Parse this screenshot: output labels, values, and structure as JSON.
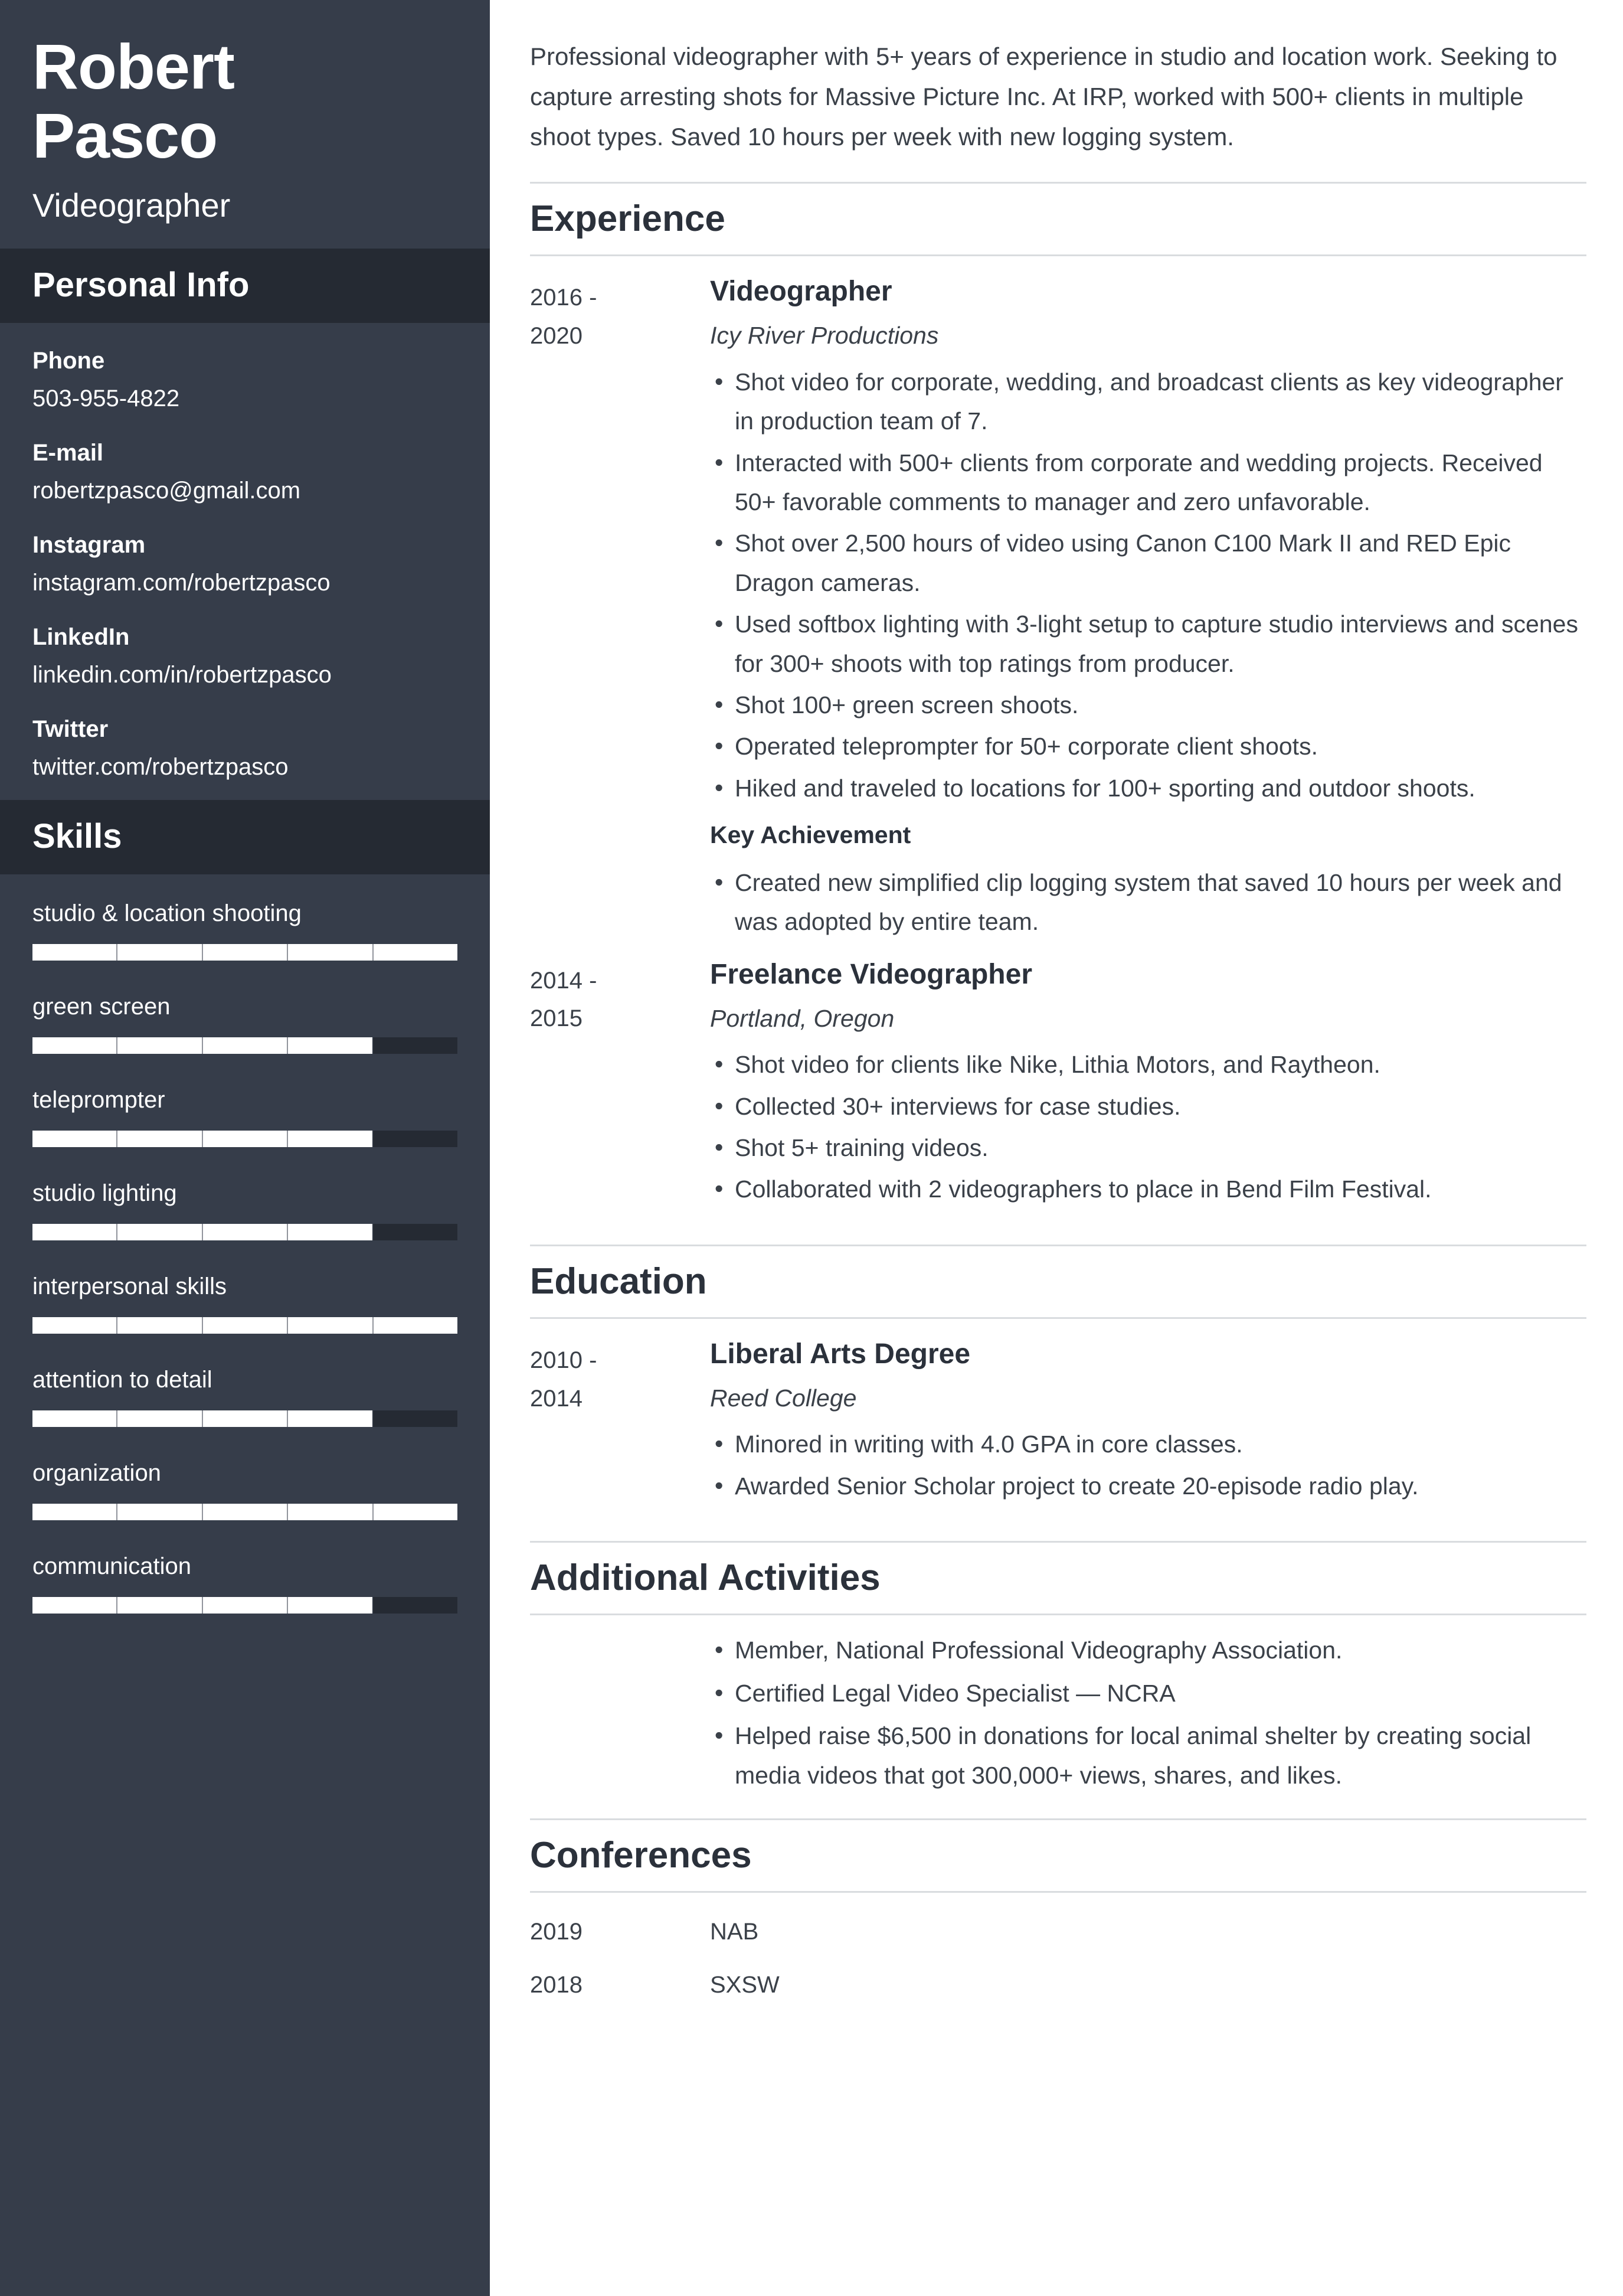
{
  "theme": {
    "sidebar_bg": "#363d4a",
    "sidebar_header_bg": "#252a33",
    "skill_track_bg": "#252a33",
    "skill_fill": "#ffffff",
    "main_bg": "#ffffff",
    "text_dark": "#3b4149",
    "heading_dark": "#2b313b",
    "rule": "#d9dcdf"
  },
  "sidebar": {
    "first_name": "Robert",
    "last_name": "Pasco",
    "job_title": "Videographer",
    "personal_info_heading": "Personal Info",
    "contacts": [
      {
        "label": "Phone",
        "value": "503-955-4822"
      },
      {
        "label": "E-mail",
        "value": "robertzpasco@gmail.com"
      },
      {
        "label": "Instagram",
        "value": "instagram.com/robertzpasco"
      },
      {
        "label": "LinkedIn",
        "value": "linkedin.com/in/robertzpasco"
      },
      {
        "label": "Twitter",
        "value": "twitter.com/robertzpasco"
      }
    ],
    "skills_heading": "Skills",
    "skills": [
      {
        "label": "studio & location shooting",
        "level": 100
      },
      {
        "label": "green screen",
        "level": 80
      },
      {
        "label": "teleprompter",
        "level": 80
      },
      {
        "label": "studio lighting",
        "level": 80
      },
      {
        "label": "interpersonal skills",
        "level": 100
      },
      {
        "label": "attention to detail",
        "level": 80
      },
      {
        "label": "organization",
        "level": 100
      },
      {
        "label": "communication",
        "level": 80
      }
    ]
  },
  "main": {
    "summary": "Professional videographer with 5+ years of experience in studio and location work. Seeking to capture arresting shots for Massive Picture Inc. At IRP, worked with 500+ clients in multiple shoot types. Saved 10 hours per week with new logging system.",
    "experience": {
      "title": "Experience",
      "entries": [
        {
          "date_from": "2016 -",
          "date_to": "2020",
          "role": "Videographer",
          "org": "Icy River Productions",
          "bullets": [
            "Shot video for corporate, wedding, and broadcast clients as key videographer in production team of 7.",
            "Interacted with 500+ clients from corporate and wedding projects. Received 50+ favorable comments to manager and zero unfavorable.",
            "Shot over 2,500 hours of video using Canon C100 Mark II and RED Epic Dragon cameras.",
            "Used softbox lighting with 3-light setup to capture studio interviews and scenes for 300+ shoots with top ratings from producer.",
            "Shot 100+ green screen shoots.",
            "Operated teleprompter for 50+ corporate client shoots.",
            "Hiked and traveled to locations for 100+ sporting and outdoor shoots."
          ],
          "achievement_label": "Key Achievement",
          "achievement_bullets": [
            "Created new simplified clip logging system that saved 10 hours per week and was adopted by entire team."
          ]
        },
        {
          "date_from": "2014 -",
          "date_to": "2015",
          "role": "Freelance Videographer",
          "org": "Portland, Oregon",
          "bullets": [
            "Shot video for clients like Nike, Lithia Motors, and Raytheon.",
            "Collected 30+ interviews for case studies.",
            "Shot 5+ training videos.",
            "Collaborated with 2 videographers to place in Bend Film Festival."
          ],
          "achievement_label": "",
          "achievement_bullets": []
        }
      ]
    },
    "education": {
      "title": "Education",
      "entries": [
        {
          "date_from": "2010 -",
          "date_to": "2014",
          "role": "Liberal Arts Degree",
          "org": "Reed College",
          "bullets": [
            "Minored in writing with 4.0 GPA in core classes.",
            "Awarded Senior Scholar project to create 20-episode radio play."
          ]
        }
      ]
    },
    "activities": {
      "title": "Additional Activities",
      "bullets": [
        "Member, National Professional Videography Association.",
        "Certified Legal Video Specialist — NCRA",
        "Helped raise $6,500 in donations for local animal shelter by creating social media videos that got 300,000+ views, shares, and likes."
      ]
    },
    "conferences": {
      "title": "Conferences",
      "rows": [
        {
          "year": "2019",
          "name": "NAB"
        },
        {
          "year": "2018",
          "name": "SXSW"
        }
      ]
    }
  }
}
